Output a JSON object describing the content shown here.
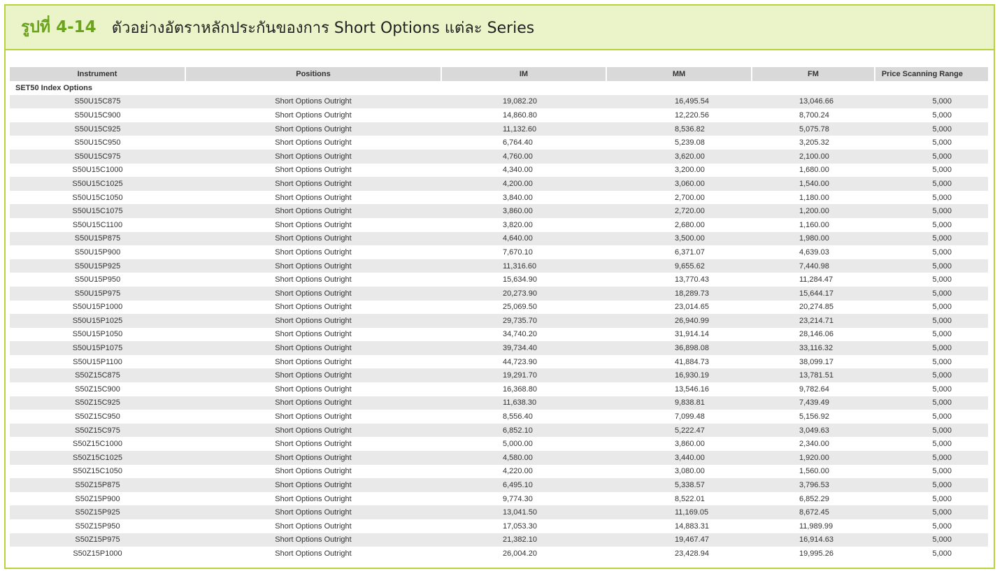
{
  "figure": {
    "number": "รูปที่ 4-14",
    "title": "ตัวอย่างอัตราหลักประกันของการ Short Options แต่ละ Series"
  },
  "table": {
    "columns": [
      "Instrument",
      "Positions",
      "IM",
      "MM",
      "FM",
      "Price Scanning Range"
    ],
    "group_label": "SET50 Index Options",
    "rows": [
      {
        "instrument": "S50U15C875",
        "position": "Short Options Outright",
        "im": "19,082.20",
        "mm": "16,495.54",
        "fm": "13,046.66",
        "psr": "5,000"
      },
      {
        "instrument": "S50U15C900",
        "position": "Short Options Outright",
        "im": "14,860.80",
        "mm": "12,220.56",
        "fm": "8,700.24",
        "psr": "5,000"
      },
      {
        "instrument": "S50U15C925",
        "position": "Short Options Outright",
        "im": "11,132.60",
        "mm": "8,536.82",
        "fm": "5,075.78",
        "psr": "5,000"
      },
      {
        "instrument": "S50U15C950",
        "position": "Short Options Outright",
        "im": "6,764.40",
        "mm": "5,239.08",
        "fm": "3,205.32",
        "psr": "5,000"
      },
      {
        "instrument": "S50U15C975",
        "position": "Short Options Outright",
        "im": "4,760.00",
        "mm": "3,620.00",
        "fm": "2,100.00",
        "psr": "5,000"
      },
      {
        "instrument": "S50U15C1000",
        "position": "Short Options Outright",
        "im": "4,340.00",
        "mm": "3,200.00",
        "fm": "1,680.00",
        "psr": "5,000"
      },
      {
        "instrument": "S50U15C1025",
        "position": "Short Options Outright",
        "im": "4,200.00",
        "mm": "3,060.00",
        "fm": "1,540.00",
        "psr": "5,000"
      },
      {
        "instrument": "S50U15C1050",
        "position": "Short Options Outright",
        "im": "3,840.00",
        "mm": "2,700.00",
        "fm": "1,180.00",
        "psr": "5,000"
      },
      {
        "instrument": "S50U15C1075",
        "position": "Short Options Outright",
        "im": "3,860.00",
        "mm": "2,720.00",
        "fm": "1,200.00",
        "psr": "5,000"
      },
      {
        "instrument": "S50U15C1100",
        "position": "Short Options Outright",
        "im": "3,820.00",
        "mm": "2,680.00",
        "fm": "1,160.00",
        "psr": "5,000"
      },
      {
        "instrument": "S50U15P875",
        "position": "Short Options Outright",
        "im": "4,640.00",
        "mm": "3,500.00",
        "fm": "1,980.00",
        "psr": "5,000"
      },
      {
        "instrument": "S50U15P900",
        "position": "Short Options Outright",
        "im": "7,670.10",
        "mm": "6,371.07",
        "fm": "4,639.03",
        "psr": "5,000"
      },
      {
        "instrument": "S50U15P925",
        "position": "Short Options Outright",
        "im": "11,316.60",
        "mm": "9,655.62",
        "fm": "7,440.98",
        "psr": "5,000"
      },
      {
        "instrument": "S50U15P950",
        "position": "Short Options Outright",
        "im": "15,634.90",
        "mm": "13,770.43",
        "fm": "11,284.47",
        "psr": "5,000"
      },
      {
        "instrument": "S50U15P975",
        "position": "Short Options Outright",
        "im": "20,273.90",
        "mm": "18,289.73",
        "fm": "15,644.17",
        "psr": "5,000"
      },
      {
        "instrument": "S50U15P1000",
        "position": "Short Options Outright",
        "im": "25,069.50",
        "mm": "23,014.65",
        "fm": "20,274.85",
        "psr": "5,000"
      },
      {
        "instrument": "S50U15P1025",
        "position": "Short Options Outright",
        "im": "29,735.70",
        "mm": "26,940.99",
        "fm": "23,214.71",
        "psr": "5,000"
      },
      {
        "instrument": "S50U15P1050",
        "position": "Short Options Outright",
        "im": "34,740.20",
        "mm": "31,914.14",
        "fm": "28,146.06",
        "psr": "5,000"
      },
      {
        "instrument": "S50U15P1075",
        "position": "Short Options Outright",
        "im": "39,734.40",
        "mm": "36,898.08",
        "fm": "33,116.32",
        "psr": "5,000"
      },
      {
        "instrument": "S50U15P1100",
        "position": "Short Options Outright",
        "im": "44,723.90",
        "mm": "41,884.73",
        "fm": "38,099.17",
        "psr": "5,000"
      },
      {
        "instrument": "S50Z15C875",
        "position": "Short Options Outright",
        "im": "19,291.70",
        "mm": "16,930.19",
        "fm": "13,781.51",
        "psr": "5,000"
      },
      {
        "instrument": "S50Z15C900",
        "position": "Short Options Outright",
        "im": "16,368.80",
        "mm": "13,546.16",
        "fm": "9,782.64",
        "psr": "5,000"
      },
      {
        "instrument": "S50Z15C925",
        "position": "Short Options Outright",
        "im": "11,638.30",
        "mm": "9,838.81",
        "fm": "7,439.49",
        "psr": "5,000"
      },
      {
        "instrument": "S50Z15C950",
        "position": "Short Options Outright",
        "im": "8,556.40",
        "mm": "7,099.48",
        "fm": "5,156.92",
        "psr": "5,000"
      },
      {
        "instrument": "S50Z15C975",
        "position": "Short Options Outright",
        "im": "6,852.10",
        "mm": "5,222.47",
        "fm": "3,049.63",
        "psr": "5,000"
      },
      {
        "instrument": "S50Z15C1000",
        "position": "Short Options Outright",
        "im": "5,000.00",
        "mm": "3,860.00",
        "fm": "2,340.00",
        "psr": "5,000"
      },
      {
        "instrument": "S50Z15C1025",
        "position": "Short Options Outright",
        "im": "4,580.00",
        "mm": "3,440.00",
        "fm": "1,920.00",
        "psr": "5,000"
      },
      {
        "instrument": "S50Z15C1050",
        "position": "Short Options Outright",
        "im": "4,220.00",
        "mm": "3,080.00",
        "fm": "1,560.00",
        "psr": "5,000"
      },
      {
        "instrument": "S50Z15P875",
        "position": "Short Options Outright",
        "im": "6,495.10",
        "mm": "5,338.57",
        "fm": "3,796.53",
        "psr": "5,000"
      },
      {
        "instrument": "S50Z15P900",
        "position": "Short Options Outright",
        "im": "9,774.30",
        "mm": "8,522.01",
        "fm": "6,852.29",
        "psr": "5,000"
      },
      {
        "instrument": "S50Z15P925",
        "position": "Short Options Outright",
        "im": "13,041.50",
        "mm": "11,169.05",
        "fm": "8,672.45",
        "psr": "5,000"
      },
      {
        "instrument": "S50Z15P950",
        "position": "Short Options Outright",
        "im": "17,053.30",
        "mm": "14,883.31",
        "fm": "11,989.99",
        "psr": "5,000"
      },
      {
        "instrument": "S50Z15P975",
        "position": "Short Options Outright",
        "im": "21,382.10",
        "mm": "19,467.47",
        "fm": "16,914.63",
        "psr": "5,000"
      },
      {
        "instrument": "S50Z15P1000",
        "position": "Short Options Outright",
        "im": "26,004.20",
        "mm": "23,428.94",
        "fm": "19,995.26",
        "psr": "5,000"
      }
    ]
  },
  "colors": {
    "accent_border": "#b6d33a",
    "title_bar_bg": "#eaf4c8",
    "figure_number": "#6ba31d",
    "header_bg": "#d9d9d9",
    "row_stripe": "#e9e9e9"
  }
}
